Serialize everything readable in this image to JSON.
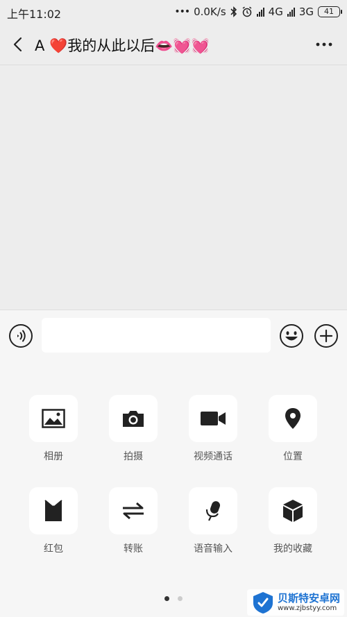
{
  "status_bar": {
    "time": "上午11:02",
    "network_speed": "0.0K/s",
    "signal1": "4G",
    "signal2": "3G",
    "battery": "41"
  },
  "header": {
    "title": "A ❤️我的从此以后👄💓💓"
  },
  "input_bar": {
    "message_value": "",
    "message_placeholder": ""
  },
  "panel": {
    "items": [
      {
        "label": "相册",
        "icon": "photo-icon"
      },
      {
        "label": "拍摄",
        "icon": "camera-icon"
      },
      {
        "label": "视频通话",
        "icon": "video-call-icon"
      },
      {
        "label": "位置",
        "icon": "location-icon"
      },
      {
        "label": "红包",
        "icon": "red-packet-icon"
      },
      {
        "label": "转账",
        "icon": "transfer-icon"
      },
      {
        "label": "语音输入",
        "icon": "microphone-icon"
      },
      {
        "label": "我的收藏",
        "icon": "favorites-icon"
      }
    ],
    "page_count": 2,
    "current_page": 1
  },
  "watermark": {
    "name": "贝斯特安卓网",
    "url": "www.zjbstyy.com"
  }
}
